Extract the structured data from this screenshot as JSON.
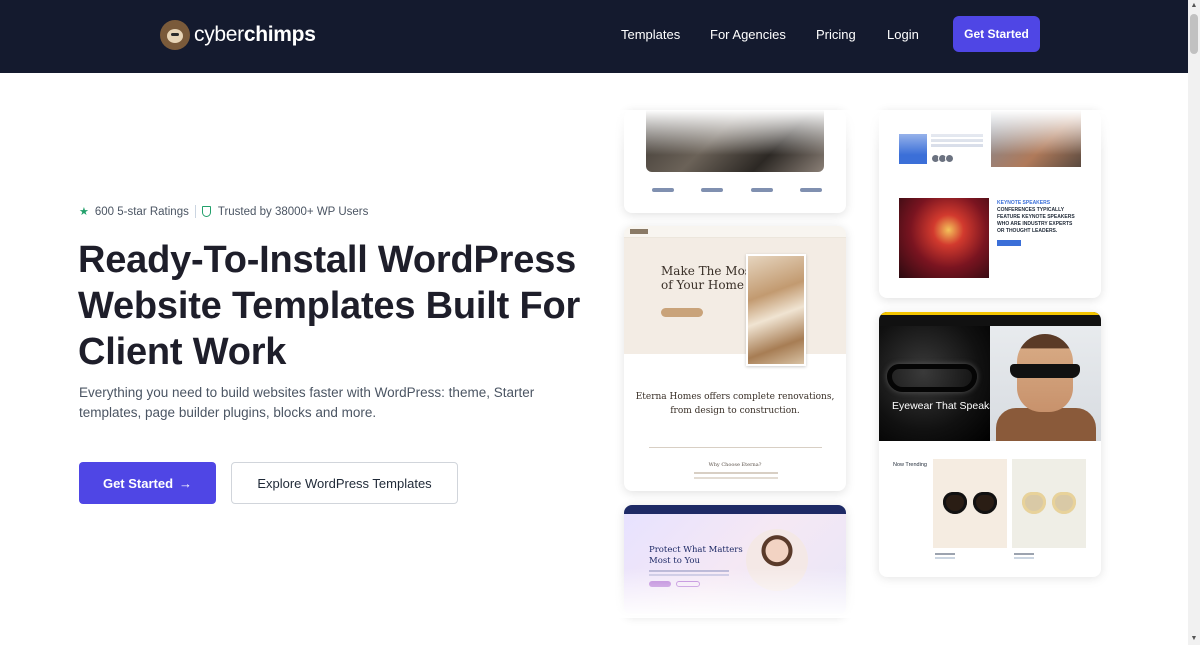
{
  "header": {
    "logo_text_light": "cyber",
    "logo_text_bold": "chimps",
    "nav": [
      "Templates",
      "For Agencies",
      "Pricing",
      "Login"
    ],
    "cta": "Get Started"
  },
  "hero": {
    "ratings": "600 5-star Ratings",
    "trusted": "Trusted by 38000+ WP Users",
    "headline": "Ready-To-Install WordPress Website Templates Built For Client Work",
    "subtext": "Everything you need to build websites faster with WordPress: theme, Starter templates, page builder plugins, blocks and more.",
    "primary_button": "Get Started",
    "primary_arrow": "→",
    "secondary_button": "Explore WordPress Templates"
  },
  "previews": {
    "keynote_title": "KEYNOTE SPEAKERS",
    "keynote_text": "CONFERENCES TYPICALLY FEATURE KEYNOTE SPEAKERS WHO ARE INDUSTRY EXPERTS OR THOUGHT LEADERS.",
    "home_title": "Make The Most of Your Home",
    "home_quote": "Eterna Homes offers complete renovations, from design to construction.",
    "home_why": "Why Choose Eterna?",
    "eyewear_title": "Eyewear That Speaks",
    "trending": "Now Trending",
    "protect_title": "Protect What Matters Most to You"
  },
  "colors": {
    "header_bg": "#141a2e",
    "accent": "#4f46e5",
    "rating_green": "#22a06b"
  },
  "icons": {
    "star": "star-icon",
    "shield": "shield-icon",
    "arrow": "arrow-right-icon",
    "logo": "chimp-logo-icon"
  }
}
